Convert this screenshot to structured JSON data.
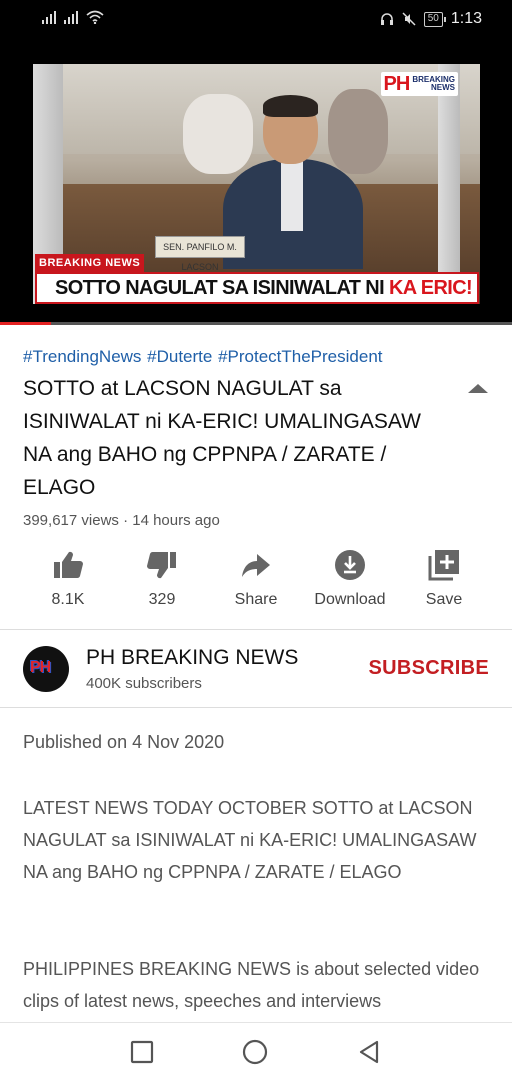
{
  "status_bar": {
    "battery": "50",
    "time": "1:13"
  },
  "video": {
    "logo_main": "PH",
    "logo_sub_1": "BREAKING",
    "logo_sub_2": "NEWS",
    "nameplate": "SEN. PANFILO M. LACSON",
    "breaking_tag": "BREAKING NEWS",
    "headline_part1": "SOTTO NAGULAT SA ISINIWALAT NI ",
    "headline_part2": "KA ERIC!",
    "progress_fraction": 0.1
  },
  "info": {
    "hashtags": "#TrendingNews #Duterte #ProtectThePresident",
    "title": "SOTTO at LACSON NAGULAT sa ISINIWALAT ni KA-ERIC! UMALINGASAW NA ang BAHO ng CPPNPA / ZARATE / ELAGO",
    "meta": "399,617 views · 14 hours ago"
  },
  "actions": {
    "like": "8.1K",
    "dislike": "329",
    "share": "Share",
    "download": "Download",
    "save": "Save"
  },
  "channel": {
    "avatar_text": "PH",
    "name": "PH BREAKING NEWS",
    "subscribers": "400K subscribers",
    "subscribe_label": "SUBSCRIBE"
  },
  "description": {
    "published": "Published on 4 Nov 2020",
    "paragraph1": "LATEST NEWS TODAY OCTOBER SOTTO at LACSON NAGULAT sa ISINIWALAT ni KA-ERIC! UMALINGASAW NA ang BAHO ng CPPNPA / ZARATE / ELAGO",
    "paragraph2": "PHILIPPINES BREAKING NEWS is about selected video clips of latest news, speeches and interviews"
  },
  "icons": {
    "like": "thumbs-up-icon",
    "dislike": "thumbs-down-icon",
    "share": "share-arrow-icon",
    "download": "download-icon",
    "save": "playlist-add-icon",
    "nav_recents": "square-icon",
    "nav_home": "circle-icon",
    "nav_back": "triangle-back-icon"
  },
  "colors": {
    "hashtag": "#1f5fa8",
    "subscribe": "#c31e22",
    "progress": "#e32121"
  }
}
